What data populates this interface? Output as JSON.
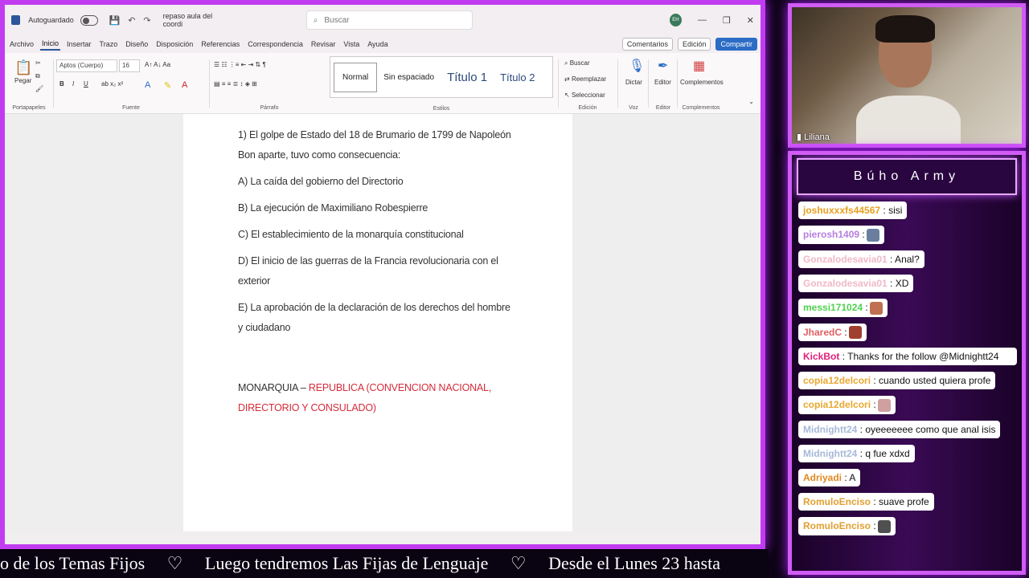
{
  "word": {
    "autosave_label": "Autoguardado",
    "doc_name": "repaso aula del coordi",
    "search_placeholder": "Buscar",
    "avatar_initials": "EH",
    "menu_tabs": [
      "Archivo",
      "Inicio",
      "Insertar",
      "Trazo",
      "Diseño",
      "Disposición",
      "Referencias",
      "Correspondencia",
      "Revisar",
      "Vista",
      "Ayuda"
    ],
    "active_tab": "Inicio",
    "comments_btn": "Comentarios",
    "edit_btn": "Edición",
    "share_btn": "Compartir",
    "ribbon": {
      "paste": "Pegar",
      "clipboard_group": "Portapapeles",
      "font_name": "Aptos (Cuerpo)",
      "font_size": "16",
      "font_group": "Fuente",
      "paragraph_group": "Párrafo",
      "styles": [
        "Normal",
        "Sin espaciado",
        "Título 1",
        "Título 2"
      ],
      "styles_group": "Estilos",
      "find": "Buscar",
      "replace": "Reemplazar",
      "select": "Seleccionar",
      "editing_group": "Edición",
      "dictate": "Dictar",
      "voice_group": "Voz",
      "editor": "Editor",
      "editor_group": "Editor",
      "addins": "Complementos",
      "addins_group": "Complementos"
    },
    "document": {
      "question": "1) El golpe de Estado del 18 de Brumario de 1799 de Napoleón Bon aparte, tuvo como consecuencia:",
      "options": [
        "A) La caída del gobierno del Directorio",
        "B) La ejecución de Maximiliano Robespierre",
        "C) El establecimiento de la monarquía constitucional",
        "D) El inicio de las guerras de la Francia revolucionaria con el exterior",
        "E) La aprobación de la declaración de los derechos del hombre y ciudadano"
      ],
      "answer_black": "MONARQUIA – ",
      "answer_red": "REPUBLICA (CONVENCION NACIONAL, DIRECTORIO Y CONSULADO)"
    }
  },
  "ticker": {
    "items": [
      "o de los Temas Fijos",
      "♡",
      "Luego tendremos Las Fijas de Lenguaje",
      "♡",
      "Desde el Lunes 23 hasta"
    ]
  },
  "camera": {
    "label": "Liliana"
  },
  "chat": {
    "title": "Búho Army",
    "messages": [
      {
        "user": "joshuxxxfs44567",
        "color": "#e6a020",
        "text": ": sisi",
        "emote": ""
      },
      {
        "user": "pierosh1409",
        "color": "#b57ee0",
        "text": " :",
        "emote": "#6a7fa0"
      },
      {
        "user": "Gonzalodesavia01",
        "color": "#f0b8c8",
        "text": ": Anal?",
        "emote": ""
      },
      {
        "user": "Gonzalodesavia01",
        "color": "#f0b8c8",
        "text": ": XD",
        "emote": ""
      },
      {
        "user": "messi171024",
        "color": "#4fd04f",
        "text": " :",
        "emote": "#c07050"
      },
      {
        "user": "JharedC",
        "color": "#e06060",
        "text": " :",
        "emote": "#a04030"
      },
      {
        "user": "KickBot",
        "color": "#e0207a",
        "text": ": Thanks for the follow @Midnightt24",
        "emote": "",
        "wide": true
      },
      {
        "user": "copia12delcori",
        "color": "#e8a830",
        "text": ": cuando usted quiera profe",
        "emote": ""
      },
      {
        "user": "copia12delcori",
        "color": "#e8a830",
        "text": " :",
        "emote": "#d0a0a0"
      },
      {
        "user": "Midnightt24",
        "color": "#a8b8d8",
        "text": ": oyeeeeeee como que anal isis",
        "emote": ""
      },
      {
        "user": "Midnightt24",
        "color": "#a8b8d8",
        "text": ": q fue xdxd",
        "emote": ""
      },
      {
        "user": "Adriyadi",
        "color": "#e08a20",
        "text": ": A",
        "emote": ""
      },
      {
        "user": "RomuloEnciso",
        "color": "#e0a030",
        "text": ": suave profe",
        "emote": ""
      },
      {
        "user": "RomuloEnciso",
        "color": "#e0a030",
        "text": " :",
        "emote": "#505050"
      }
    ]
  }
}
